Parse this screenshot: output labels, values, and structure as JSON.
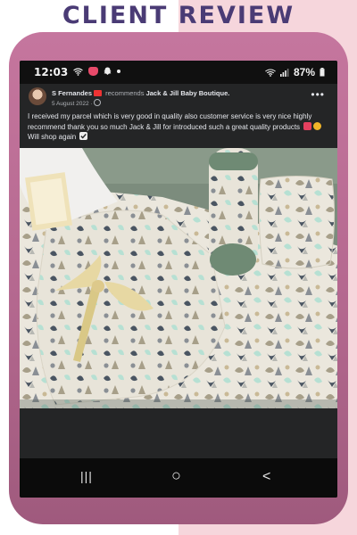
{
  "banner": {
    "title": "CLIENT REVIEW"
  },
  "statusbar": {
    "time": "12:03",
    "battery": "87%"
  },
  "post": {
    "author": "S Fernandes",
    "verb": "recommends",
    "page": "Jack & Jill Baby Boutique.",
    "date": "5 August 2022",
    "audience_separator": "·",
    "more_label": "•••",
    "text": "I received my parcel which is very good in quality also customer service is very nice highly recommend thank you so much Jack & Jill for introduced such a great quality products",
    "text_tail": "Will shop again"
  },
  "navbar": {
    "recent_label": "|||",
    "home_label": "○",
    "back_label": "<"
  },
  "colors": {
    "banner_text": "#4a3b75",
    "frame": "#b4688f",
    "phone_bg": "#242526",
    "bedding_bg": "#e9e4d8",
    "ribbon": "#e7d8a3",
    "pillow_green": "#6f8a74"
  },
  "icons": [
    "wifi-icon",
    "cat-emoji-icon",
    "snapchat-icon",
    "signal-icon",
    "battery-icon",
    "globe-icon",
    "heart-emoji-icon",
    "check-emoji-icon",
    "recent-apps-icon",
    "home-icon",
    "back-icon"
  ]
}
